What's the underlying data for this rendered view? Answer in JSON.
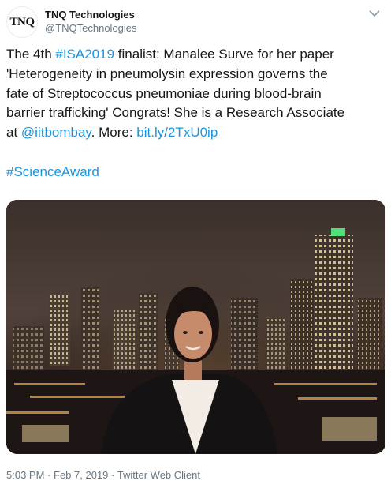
{
  "author": {
    "avatar_text": "TNQ",
    "name": "TNQ Technologies",
    "handle": "@TNQTechnologies"
  },
  "tweet": {
    "lines": [
      [
        {
          "t": "The 4th ",
          "link": false
        },
        {
          "t": "#ISA2019",
          "link": true
        },
        {
          "t": " finalist: Manalee Surve for her paper",
          "link": false
        }
      ],
      [
        {
          "t": "'Heterogeneity in pneumolysin expression governs the",
          "link": false
        }
      ],
      [
        {
          "t": "fate of Streptococcus pneumoniae during blood-brain",
          "link": false
        }
      ],
      [
        {
          "t": "barrier trafficking' Congrats! She is a Research Associate",
          "link": false
        }
      ],
      [
        {
          "t": "at ",
          "link": false
        },
        {
          "t": "@iitbombay",
          "link": true
        },
        {
          "t": ". More: ",
          "link": false
        },
        {
          "t": "bit.ly/2TxU0ip",
          "link": true
        }
      ],
      [],
      [
        {
          "t": "#ScienceAward",
          "link": true
        }
      ]
    ]
  },
  "meta": {
    "time": "5:03 PM",
    "separator": "·",
    "date": "Feb 7, 2019",
    "client": "Twitter Web Client"
  },
  "colors": {
    "link": "#1b95e0",
    "text": "#14171a",
    "secondary": "#657786"
  },
  "icons": {
    "menu": "chevron-down-icon"
  }
}
